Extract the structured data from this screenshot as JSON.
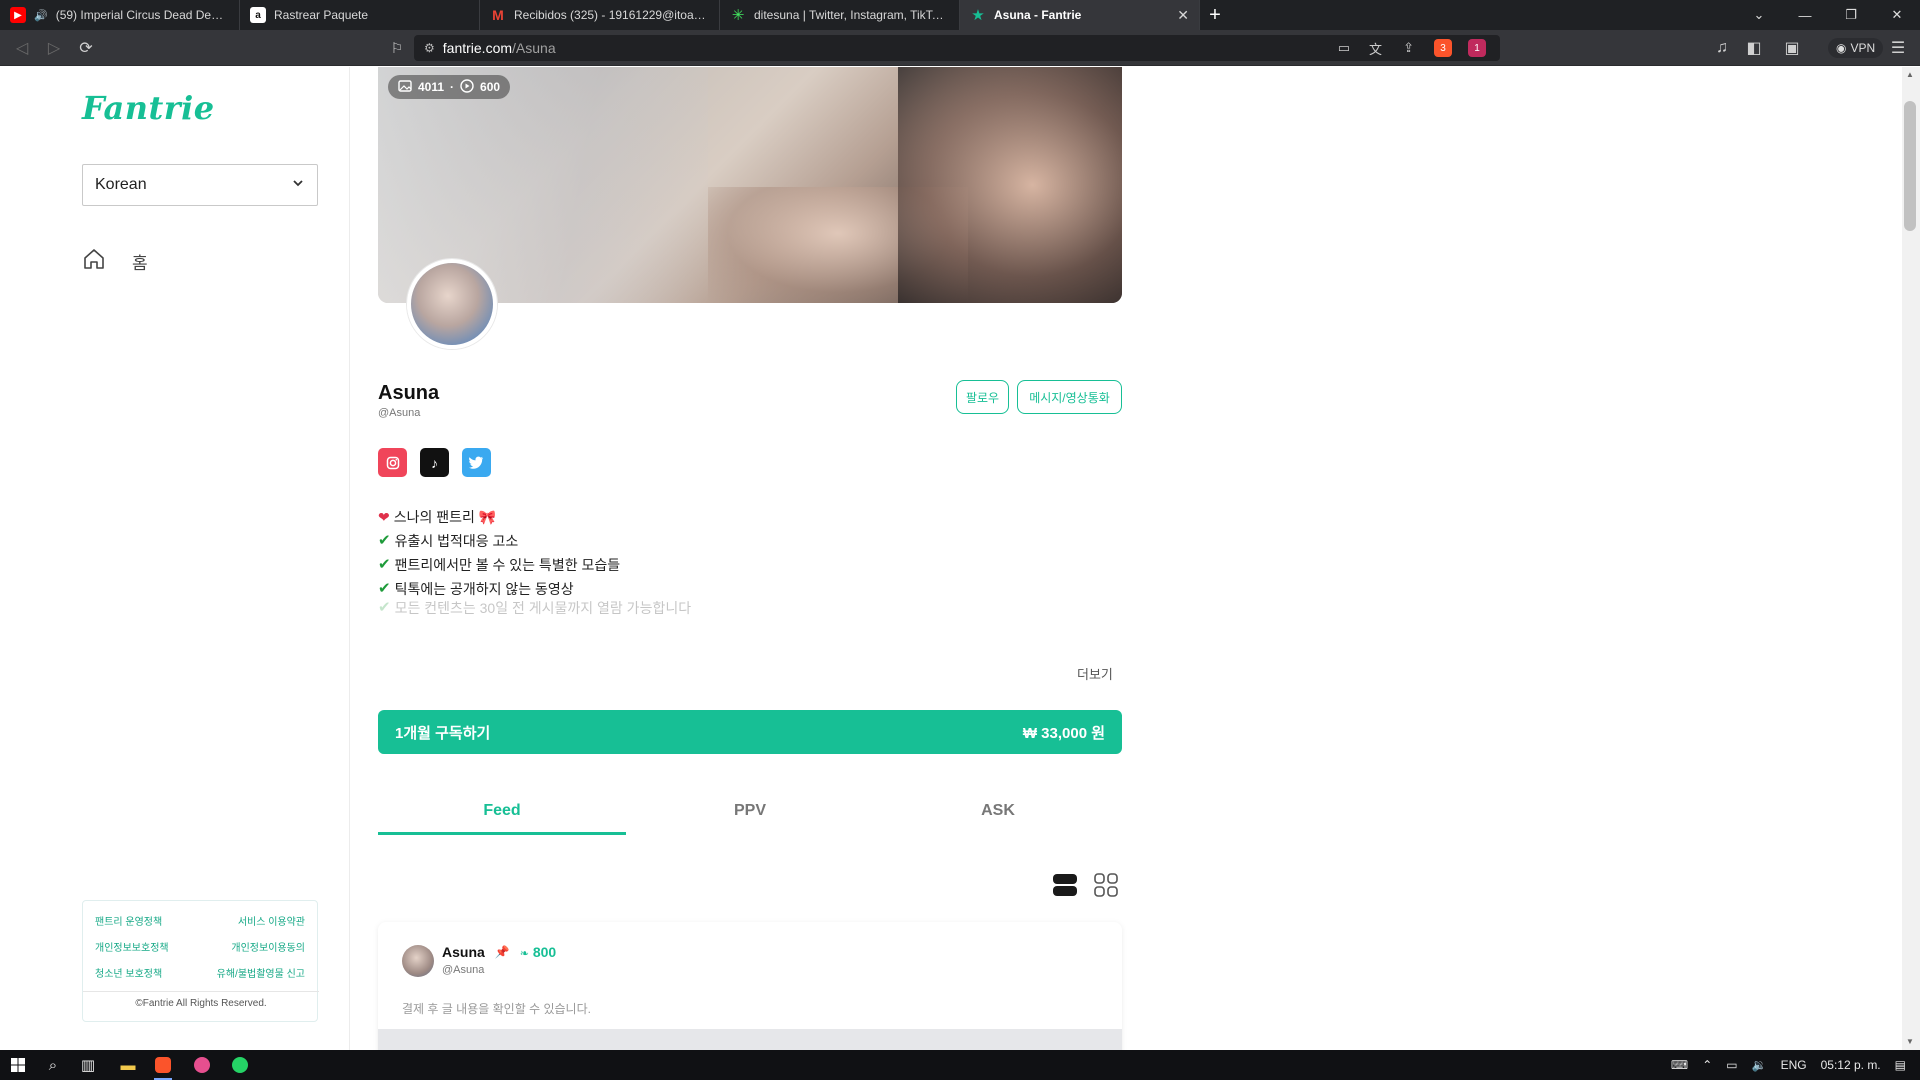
{
  "browser": {
    "tabs": [
      {
        "title": "(59) Imperial Circus Dead Decaden",
        "icon": "youtube-icon",
        "color": "#ff0000"
      },
      {
        "title": "Rastrear Paquete",
        "icon": "amazon-icon",
        "color": "#ffffff"
      },
      {
        "title": "Recibidos (325) - 19161229@itoaxaca",
        "icon": "gmail-icon",
        "color": "#ea4335"
      },
      {
        "title": "ditesuna | Twitter, Instagram, TikTok | L",
        "icon": "linktree-icon",
        "color": "#43e660"
      },
      {
        "title": "Asuna - Fantrie",
        "icon": "fantrie-icon",
        "color": "#17bf95"
      }
    ],
    "url_host": "fantrie.com",
    "url_path": "/Asuna",
    "vpn_label": "VPN",
    "brave_badge": "3",
    "rewards_badge": "1"
  },
  "sidebar": {
    "logo": "Fantrie",
    "language": "Korean",
    "nav_home": "홈",
    "footer_links": [
      "팬트리 운영정책",
      "서비스 이용약관",
      "개인정보보호정책",
      "개인정보이용동의",
      "청소년 보호정책",
      "유해/불법촬영물 신고"
    ],
    "copyright": "©Fantrie All Rights Reserved."
  },
  "profile": {
    "photo_count": "4011",
    "video_count": "600",
    "name": "Asuna",
    "handle": "@Asuna",
    "follow_label": "팔로우",
    "message_label": "메시지/영상통화",
    "bio": [
      "스나의 팬트리",
      "유출시 법적대응 고소",
      "팬트리에서만 볼 수 있는 특별한 모습들",
      "틱톡에는 공개하지 않는 동영상",
      "모든 컨텐츠는 30일 전 게시물까지 열람 가능합니다"
    ],
    "more_label": "더보기",
    "subscribe_label": "1개월 구독하기",
    "subscribe_price": "₩ 33,000 원"
  },
  "tabs": [
    "Feed",
    "PPV",
    "ASK"
  ],
  "active_tab": "Feed",
  "post": {
    "name": "Asuna",
    "price": "800",
    "handle": "@Asuna",
    "locked_text": "결제 후 글 내용을 확인할 수 있습니다."
  },
  "taskbar": {
    "lang": "ENG",
    "time": "05:12 p. m."
  },
  "colors": {
    "accent": "#17bf95",
    "instagram": "#f0455a",
    "tiktok": "#111111",
    "twitter": "#3aa9f0"
  }
}
